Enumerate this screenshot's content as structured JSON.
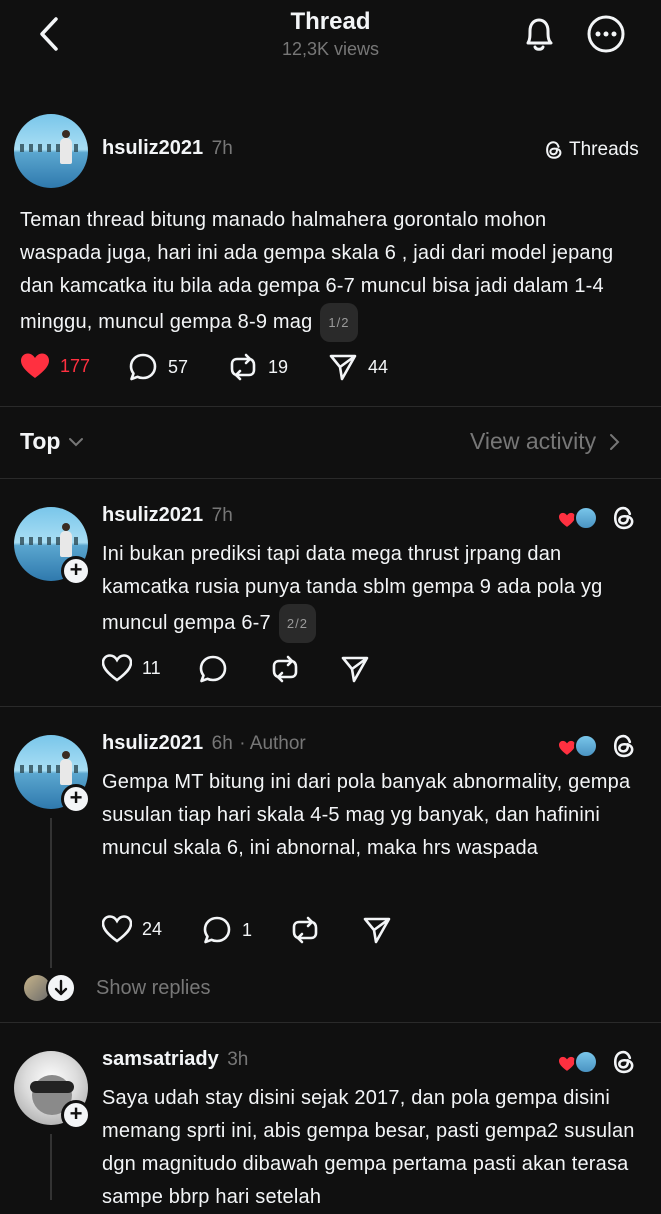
{
  "header": {
    "title": "Thread",
    "views": "12,3K views"
  },
  "main_post": {
    "username": "hsuliz2021",
    "time": "7h",
    "source_label": "Threads",
    "text": "Teman thread bitung manado halmahera gorontalo mohon waspada juga, hari ini ada gempa skala 6 , jadi dari model jepang dan kamcatka itu bila ada gempa 6-7 muncul bisa jadi dalam 1-4 minggu, muncul gempa 8-9 mag",
    "pager": "1/2",
    "likes": "177",
    "comments": "57",
    "reposts": "19",
    "shares": "44",
    "liked": true,
    "like_color": "#ff3040"
  },
  "sort": {
    "label": "Top",
    "view_activity": "View activity"
  },
  "replies": [
    {
      "username": "hsuliz2021",
      "time": "7h",
      "author_tag": "",
      "text": "Ini bukan prediksi tapi data mega thrust jrpang dan kamcatka rusia punya tanda sblm gempa 9 ada pola yg muncul gempa 6-7",
      "pager": "2/2",
      "likes": "11",
      "comments": "",
      "reposts": "",
      "shares": ""
    },
    {
      "username": "hsuliz2021",
      "time": "6h",
      "author_tag": "· Author",
      "text": "Gempa MT bitung ini dari pola banyak abnormality, gempa susulan tiap hari skala 4-5 mag yg banyak, dan hafinini muncul skala 6, ini abnornal, maka hrs waspada",
      "likes": "24",
      "comments": "1",
      "reposts": "",
      "shares": "",
      "show_replies": "Show replies"
    },
    {
      "username": "samsatriady",
      "time": "3h",
      "text": "Saya udah stay disini sejak 2017, dan pola gempa disini memang sprti ini, abis gempa besar, pasti gempa2 susulan dgn magnitudo dibawah gempa pertama pasti akan terasa sampe bbrp hari setelah"
    }
  ],
  "icons": {
    "back": "chevron-left-icon",
    "bell": "bell-icon",
    "more": "more-horizontal-icon",
    "threads": "threads-logo-icon",
    "like": "heart-icon",
    "comment": "comment-icon",
    "repost": "repost-icon",
    "share": "send-icon"
  }
}
